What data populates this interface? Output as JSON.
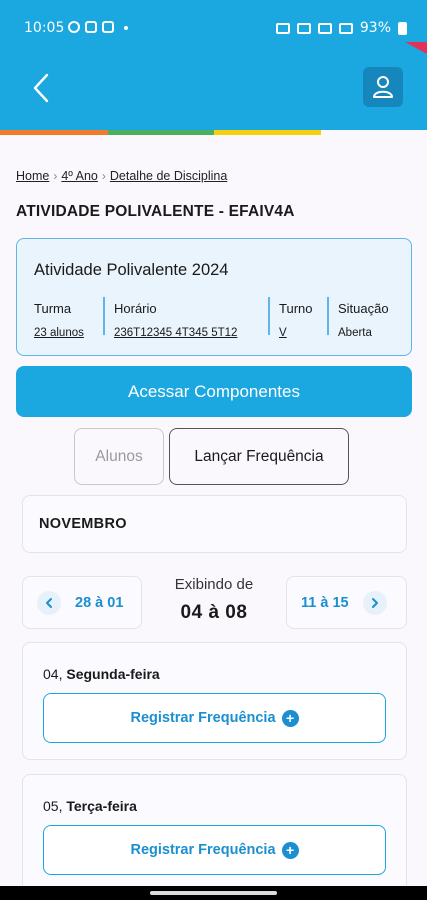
{
  "status_bar": {
    "time": "10:05",
    "battery": "93%"
  },
  "header": {
    "back_icon": "chevron-left-icon",
    "profile_icon": "user-icon"
  },
  "colors": {
    "primary": "#1ba8e0",
    "link": "#1b8fd0",
    "stripe_orange": "#f07c2b",
    "stripe_green": "#49b060",
    "stripe_blue": "#2a8dd6",
    "stripe_yellow": "#f6cf0d"
  },
  "breadcrumb": [
    "Home",
    "4º Ano",
    "Detalhe de Disciplina"
  ],
  "page_title": "ATIVIDADE POLIVALENTE - EFAIV4A",
  "info": {
    "title": "Atividade Polivalente 2024",
    "turma_label": "Turma",
    "turma_value": "23 alunos",
    "horario_label": "Horário",
    "horario_value": "236T12345 4T345 5T12",
    "turno_label": "Turno",
    "turno_value": "V",
    "situacao_label": "Situação",
    "situacao_value": "Aberta"
  },
  "primary_button": "Acessar Componentes",
  "toggles": {
    "alunos": "Alunos",
    "frequencia": "Lançar Frequência"
  },
  "month": "NOVEMBRO",
  "week_nav": {
    "prev": "28 à 01",
    "caption": "Exibindo de",
    "current": "04 à 08",
    "next": "11 à 15"
  },
  "days": [
    {
      "num": "04,",
      "name": "Segunda-feira",
      "button": "Registrar Frequência"
    },
    {
      "num": "05,",
      "name": "Terça-feira",
      "button": "Registrar Frequência"
    }
  ]
}
